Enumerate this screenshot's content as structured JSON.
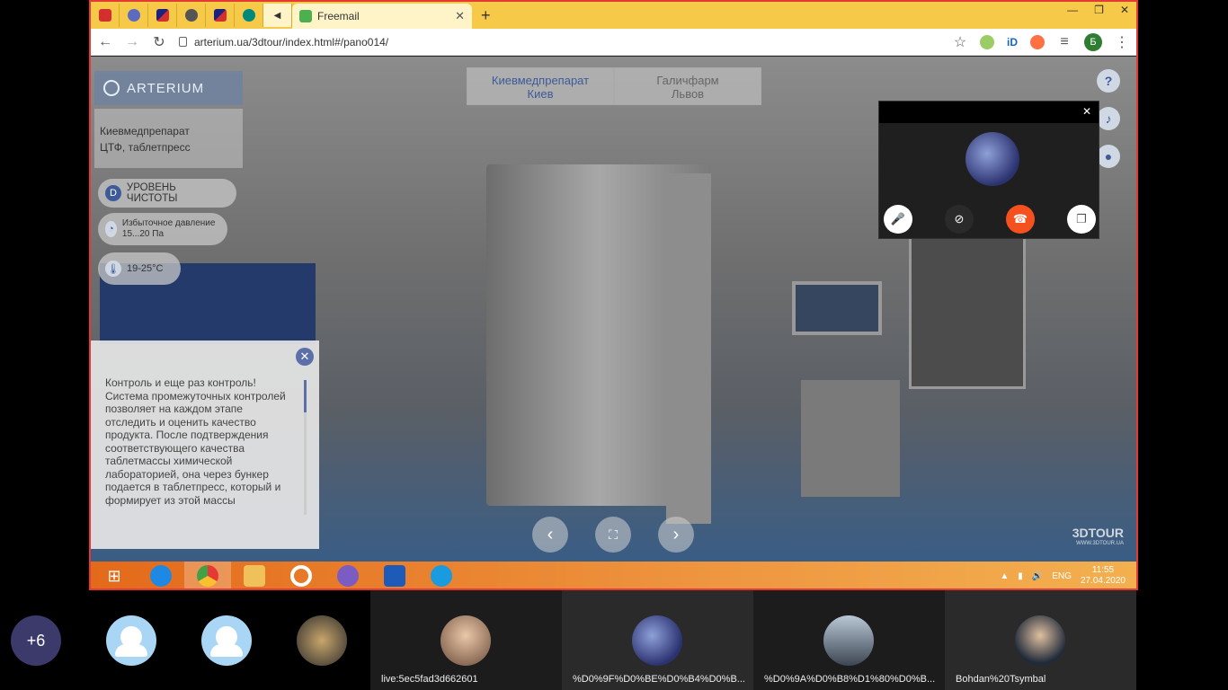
{
  "browser": {
    "active_tab_title": "Freemail",
    "new_tab": "+",
    "url": "arterium.ua/3dtour/index.html#/pano014/",
    "profile_initial": "Б"
  },
  "tour": {
    "logo": "ARTERIUM",
    "location_line1": "Киевмедпрепарат",
    "location_line2": "ЦТФ, таблетпресс",
    "cleanliness_icon": "D",
    "cleanliness": "УРОВЕНЬ ЧИСТОТЫ",
    "pressure": "Избыточное давление 15...20 Па",
    "temperature": "19-25°С",
    "city1_name": "Киевмедпрепарат",
    "city1_town": "Киев",
    "city2_name": "Галичфарм",
    "city2_town": "Львов",
    "info_text": "Контроль и еще раз контроль! Система промежуточных контролей позволяет на каждом этапе отследить и оценить качество продукта. После подтверждения соответствующего качества таблетмассы химической лабораторией, она через бункер подается в таблетпресс, который и формирует из этой массы",
    "watermark": "3DTOUR",
    "watermark_sub": "WWW.3DTOUR.UA"
  },
  "taskbar": {
    "language": "ENG",
    "time": "11:55",
    "date": "27.04.2020"
  },
  "participants": [
    {
      "label": "+6",
      "name": ""
    },
    {
      "label": "",
      "name": ""
    },
    {
      "label": "",
      "name": ""
    },
    {
      "label": "",
      "name": ""
    },
    {
      "label": "",
      "name": "live:5ec5fad3d662601"
    },
    {
      "label": "",
      "name": "%D0%9F%D0%BE%D0%B4%D0%B..."
    },
    {
      "label": "",
      "name": "%D0%9A%D0%B8%D1%80%D0%B..."
    },
    {
      "label": "",
      "name": "Bohdan%20Tsymbal"
    }
  ],
  "colors": {
    "tabbar": "#f7c948",
    "frame_border": "#e53935",
    "accent": "#3d5a99",
    "hangup": "#f4511e"
  }
}
